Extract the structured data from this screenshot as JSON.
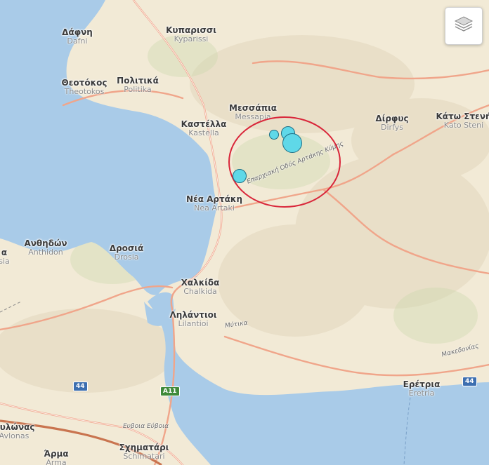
{
  "map": {
    "layers_button_label": "",
    "icons": {
      "layers": "layers-icon"
    },
    "colors": {
      "land": "#f2ead6",
      "water": "#a9cbe8",
      "road": "#f0a58a",
      "highlight_circle": "#d9263a",
      "quake_fill": "#5fd8e8",
      "quake_stroke": "#1f6f86"
    },
    "places": [
      {
        "id": "dafni",
        "greek": "Δάφνη",
        "latin": "Dafni"
      },
      {
        "id": "kyparissi",
        "greek": "Κυπαρισσι",
        "latin": "Kyparissi"
      },
      {
        "id": "theotokos",
        "greek": "Θεοτόκος",
        "latin": "Theotokos"
      },
      {
        "id": "politika",
        "greek": "Πολιτικά",
        "latin": "Politika"
      },
      {
        "id": "messapia",
        "greek": "Μεσσάπια",
        "latin": "Messapia"
      },
      {
        "id": "kastella",
        "greek": "Καστέλλα",
        "latin": "Kastella"
      },
      {
        "id": "dirfys",
        "greek": "Δίρφυς",
        "latin": "Dirfys"
      },
      {
        "id": "katosteni",
        "greek": "Κάτω Στενή",
        "latin": "Kato Steni"
      },
      {
        "id": "neaartaki",
        "greek": "Νέα Αρτάκη",
        "latin": "Nea Artaki"
      },
      {
        "id": "anthidon",
        "greek": "Ανθηδών",
        "latin": "Anthidon"
      },
      {
        "id": "drosia",
        "greek": "Δροσιά",
        "latin": "Drosia"
      },
      {
        "id": "chalkida",
        "greek": "Χαλκίδα",
        "latin": "Chalkida"
      },
      {
        "id": "lilantioi",
        "greek": "Ληλάντιοι",
        "latin": "Lilantioi"
      },
      {
        "id": "eretria",
        "greek": "Ερέτρια",
        "latin": "Eretria"
      },
      {
        "id": "schimatari",
        "greek": "Σχηματάρι",
        "latin": "Schimatari"
      },
      {
        "id": "arma",
        "greek": "Άρμα",
        "latin": "Arma"
      },
      {
        "id": "avlonas",
        "greek": "Αυλώνας",
        "latin": "Avlonas"
      },
      {
        "id": "edge-sia",
        "greek": "α",
        "latin": "sia"
      }
    ],
    "road_labels": {
      "provincial": "Επαρχιακή Οδός Αρτάκης Κύμης",
      "mytika": "Μύτικα",
      "makedonias": "Μακεδονίας",
      "evvoia": "Ευβοια Εύβοια"
    },
    "shields": {
      "a44_left": "44",
      "a44_right": "44",
      "a11": "A11"
    },
    "earthquakes": [
      {
        "id": "eq1",
        "magnitude_class": "small"
      },
      {
        "id": "eq2",
        "magnitude_class": "medium"
      },
      {
        "id": "eq3",
        "magnitude_class": "large"
      },
      {
        "id": "eq4",
        "magnitude_class": "medium"
      }
    ]
  }
}
